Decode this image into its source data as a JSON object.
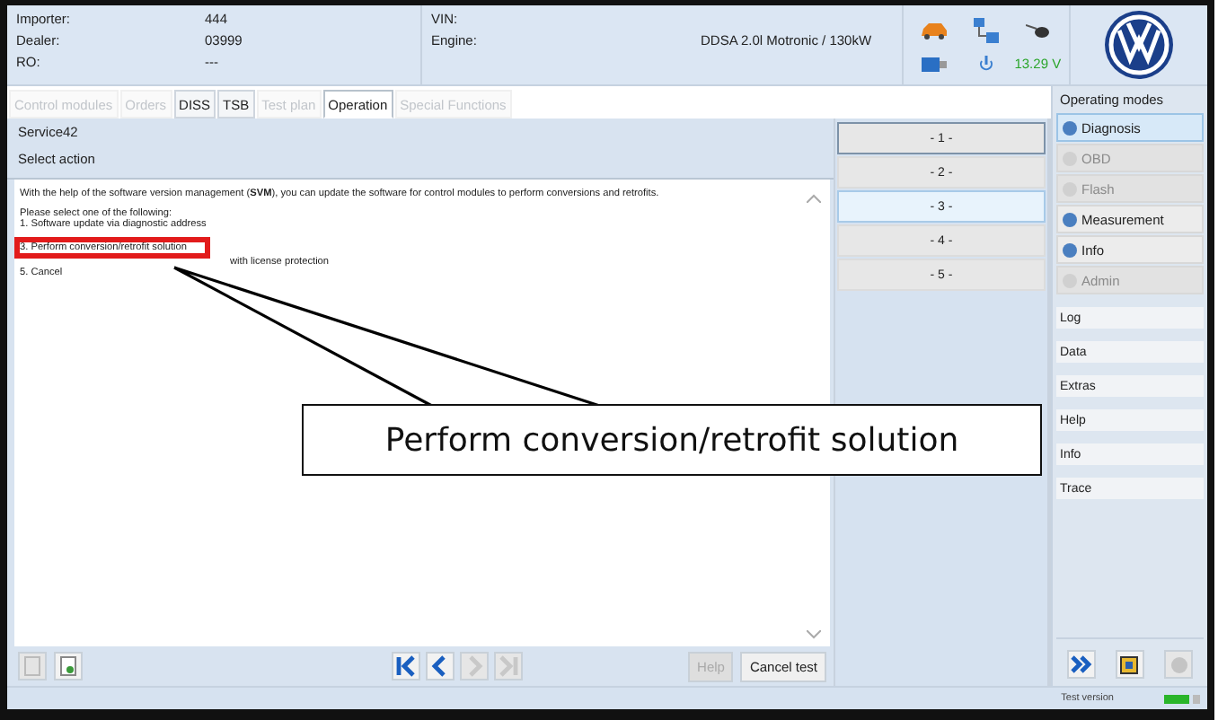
{
  "header": {
    "fields": [
      {
        "label": "Importer:",
        "value": "444"
      },
      {
        "label": "Dealer:",
        "value": "03999"
      },
      {
        "label": "RO:",
        "value": "---"
      }
    ],
    "vehicle": [
      {
        "label": "VIN:"
      },
      {
        "label": "Engine:",
        "value": "DDSA 2.0l Motronic / 130kW"
      }
    ],
    "voltage": "13.29 V"
  },
  "tabs": [
    {
      "label": "Control modules",
      "disabled": true,
      "selected": false
    },
    {
      "label": "Orders",
      "disabled": true,
      "selected": false
    },
    {
      "label": "DISS",
      "disabled": false,
      "selected": false
    },
    {
      "label": "TSB",
      "disabled": false,
      "selected": false
    },
    {
      "label": "Test plan",
      "disabled": true,
      "selected": false
    },
    {
      "label": "Operation",
      "disabled": false,
      "selected": true
    },
    {
      "label": "Special Functions",
      "disabled": true,
      "selected": false
    }
  ],
  "panel": {
    "title": "Service42",
    "subtitle": "Select action",
    "intro": "With the help of the software version management (**SVM**), you can update the software for control modules to perform conversions and retrofits.",
    "prompt": "Please select one of the following:",
    "options": [
      {
        "text": "1. Software update via diagnostic address",
        "indent": false
      },
      {
        "text": "3. Perform conversion/retrofit solution",
        "indent": false,
        "highlighted": true
      },
      {
        "text": "with license protection",
        "indent": true
      },
      {
        "text": "5. Cancel",
        "indent": false
      }
    ]
  },
  "choices": [
    {
      "label": "- 1 -",
      "focused": true,
      "selected": false
    },
    {
      "label": "- 2 -",
      "focused": false,
      "selected": false
    },
    {
      "label": "- 3 -",
      "focused": false,
      "selected": true
    },
    {
      "label": "- 4 -",
      "focused": false,
      "selected": false
    },
    {
      "label": "- 5 -",
      "focused": false,
      "selected": false
    }
  ],
  "sidebar": {
    "title": "Operating modes",
    "modes": [
      {
        "label": "Diagnosis",
        "disabled": false,
        "selected": true
      },
      {
        "label": "OBD",
        "disabled": true,
        "selected": false
      },
      {
        "label": "Flash",
        "disabled": true,
        "selected": false
      },
      {
        "label": "Measurement",
        "disabled": false,
        "selected": false
      },
      {
        "label": "Info",
        "disabled": false,
        "selected": false
      },
      {
        "label": "Admin",
        "disabled": true,
        "selected": false
      }
    ],
    "sections": [
      "Log",
      "Data",
      "Extras",
      "Help",
      "Info",
      "Trace"
    ]
  },
  "buttons": [
    {
      "label": "Help",
      "disabled": true
    },
    {
      "label": "Cancel test",
      "disabled": false
    }
  ],
  "status": "Test version",
  "callout": "Perform conversion/retrofit solution"
}
